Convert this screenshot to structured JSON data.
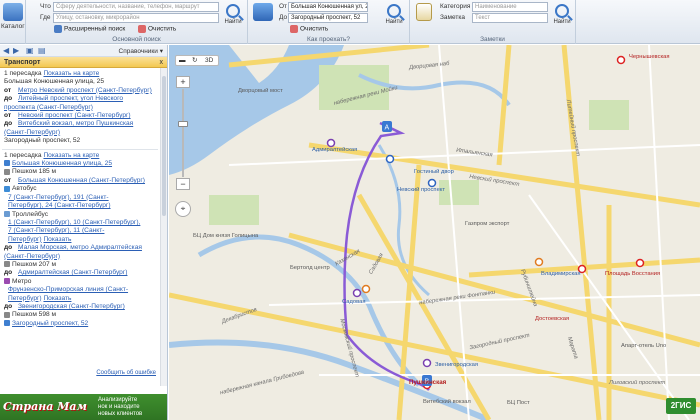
{
  "ribbon": {
    "catalog": {
      "label": "Каталог"
    },
    "search_group": {
      "what_label": "Что",
      "what_placeholder": "Сферу деятельности, название, телефон, маршрут",
      "where_label": "Где",
      "where_placeholder": "Улицу, остановку, микрорайон",
      "search_label": "Найти",
      "advanced_label": "Расширенный поиск",
      "clear_label": "Очистить",
      "caption": "Основной поиск"
    },
    "route_group": {
      "from_label": "От",
      "from_value": "Большая Конюшенная ул, 25",
      "to_label": "До",
      "to_value": "Загородный проспект, 52",
      "search_label": "Найти",
      "clear_label": "Очистить",
      "caption": "Как проехать?"
    },
    "notes_group": {
      "category_label": "Категория",
      "category_value": "Наименование",
      "note_label": "Заметка",
      "note_placeholder": "Текст",
      "search_label": "Найти",
      "caption": "Заметки"
    }
  },
  "panel": {
    "toolbar": {
      "reference_label": "Справочники"
    },
    "title": "Транспорт",
    "close": "x",
    "summary": {
      "transfers": "1 пересадка",
      "show_on_map": "Показать на карте",
      "address": "Большая Конюшенная улица, 25",
      "rows": [
        {
          "label": "от",
          "text": "Метро Невский проспект (Санкт-Петербург)"
        },
        {
          "label": "до",
          "text": "Литейный проспект, угол Невского"
        },
        {
          "label": "",
          "text": "проспекта (Санкт-Петербург)"
        },
        {
          "label": "от",
          "text": "Невский проспект (Санкт-Петербург)"
        },
        {
          "label": "до",
          "text": "Витебский вокзал, метро Пушкинская"
        },
        {
          "label": "",
          "text": "(Санкт-Петербург)"
        }
      ],
      "destination": "Загородный проспект, 52"
    },
    "detail": {
      "transfers": "1 пересадка",
      "show_on_map": "Показать на карте",
      "start": "Большая Конюшенная улица, 25",
      "walk1": "Пешком 185 м",
      "walk1_from": "от",
      "walk1_to": "Большая Конюшенная (Санкт-Петербург)",
      "bus_label": "Автобус",
      "bus_lines": [
        "7 (Санкт-Петербург), 191 (Санкт-",
        "Петербург), 24 (Санкт-Петербург)"
      ],
      "trolley_label": "Троллейбус",
      "trolley_lines": [
        "1 (Санкт-Петербург), 10 (Санкт-Петербург),",
        "7 (Санкт-Петербург), 11 (Санкт-",
        "Петербург)"
      ],
      "show": "Показать",
      "stop_to": "до",
      "stop": "Малая Морская, метро Адмиралтейская",
      "stop2": "(Санкт-Петербург)",
      "walk2": "Пешком 207 м",
      "walk2_to": "Адмиралтейская (Санкт-Петербург)",
      "metro_label": "Метро",
      "metro_line": "Фрунзенско-Приморская линия (Санкт-",
      "metro_line2": "Петербург)",
      "metro_to": "до",
      "metro_station": "Звенигородская (Санкт-Петербург)",
      "walk3": "Пешком 598 м",
      "end": "Загородный проспект, 52",
      "report": "Сообщить об ошибке"
    },
    "banner": {
      "brand": "Страна Мам",
      "text_lines": [
        "Анализируйте",
        "нок и находите",
        "новых клиентов"
      ]
    }
  },
  "map": {
    "toolbar": {
      "view3d": "3D"
    },
    "logo": "2ГИС",
    "labels": {
      "dvortsovy_most": "Дворцовый мост",
      "admiralteyskaya": "Адмиралтейская",
      "nevsky_metro": "Невский проспект",
      "nevsky_street": "Невский проспект",
      "gostiny": "Гостиный двор",
      "gazprom": "Газпром экспорт",
      "sadovaya": "Садовая",
      "kazanskaya": "Казанская",
      "bertold": "Бертолд центр",
      "vladimirskaya": "Владимирская",
      "dostoevskaya": "Достоевская",
      "zvenigorodskaya": "Звенигородская",
      "pushkinskaya": "Пушкинская",
      "vitebsky": "Витебский вокзал",
      "ploshchad_vosstaniya": "Площадь Восстания",
      "chernyshevskaya": "Чернышевская",
      "liteyny": "Литейный проспект",
      "ligovsky": "Лиговский проспект",
      "moika": "набережная реки Мойки",
      "fontanka": "набережная реки Фонтанки",
      "griboedova": "набережная канала Грибоедова",
      "sadovaya_st": "Садовая",
      "italyanskaya": "Итальянская",
      "zagorodny": "Загородный проспект",
      "moskovsky": "Московский проспект",
      "rubinshteyna": "Рубинштейна",
      "marata": "Марата",
      "bdk": "БЦ Дом князя Голицына",
      "aparthotel": "Апарт-отель Uno",
      "bts": "БЦ Пост",
      "dvortsovaya_nab": "Дворцовая наб",
      "kalinkina": "Декабристов"
    }
  }
}
